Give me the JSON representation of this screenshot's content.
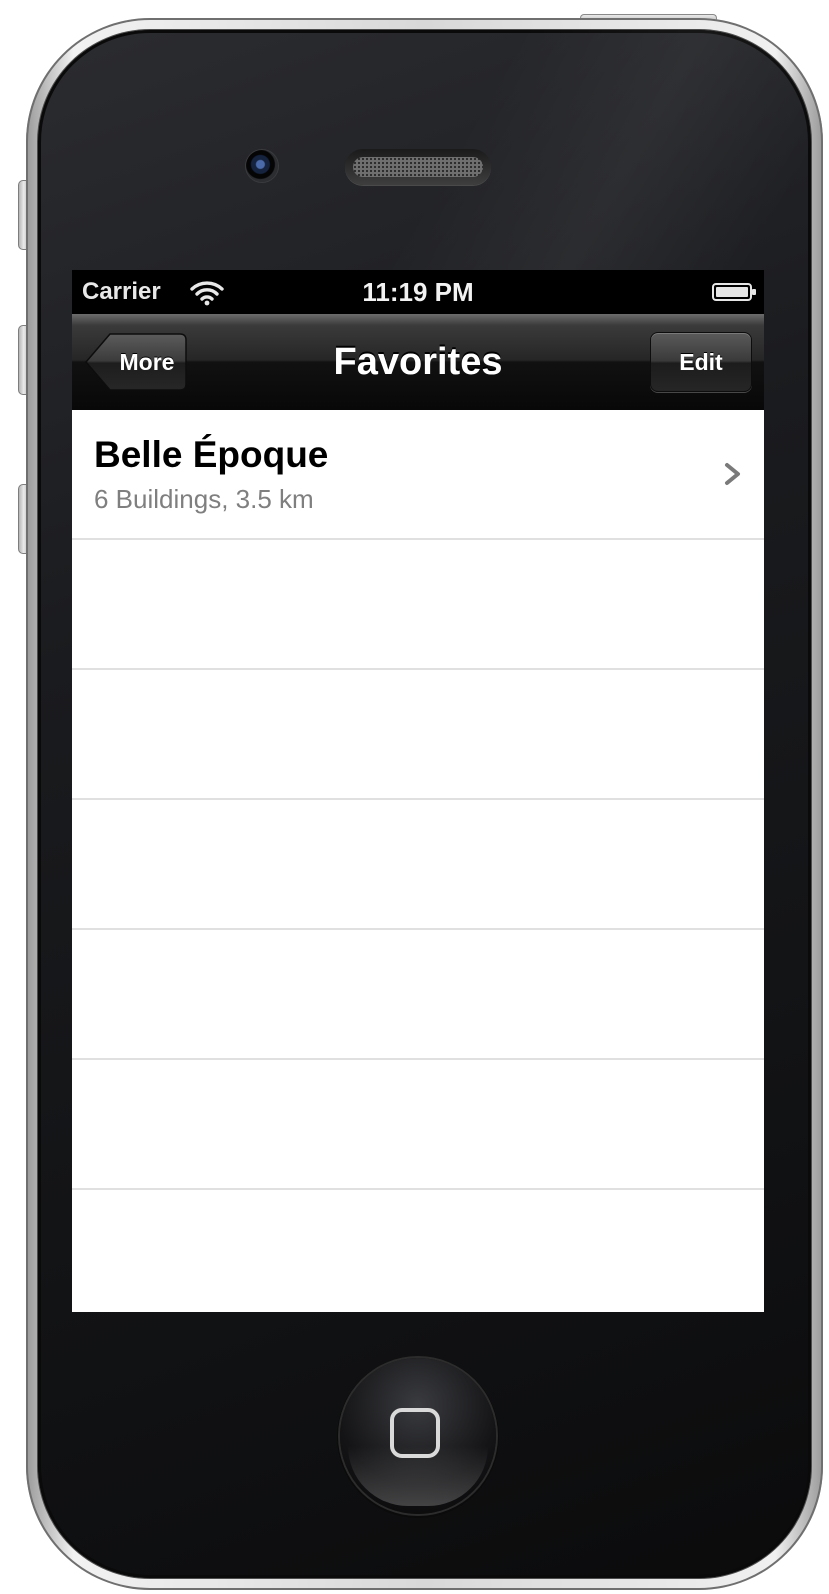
{
  "status_bar": {
    "carrier": "Carrier",
    "time": "11:19 PM",
    "wifi_icon": "wifi-icon",
    "battery_icon": "battery-icon"
  },
  "nav_bar": {
    "back_label": "More",
    "title": "Favorites",
    "edit_label": "Edit"
  },
  "list": {
    "items": [
      {
        "title": "Belle Époque",
        "subtitle": "6 Buildings, 3.5 km",
        "accessory_icon": "chevron-right-icon"
      }
    ],
    "empty_row_count": 5
  },
  "device": {
    "home_button_icon": "home-button-icon"
  },
  "colors": {
    "nav_bar": "#1e1e1e",
    "status_bar": "#000000",
    "subtitle": "#7f7f7f",
    "separator": "#e0e0e0"
  }
}
